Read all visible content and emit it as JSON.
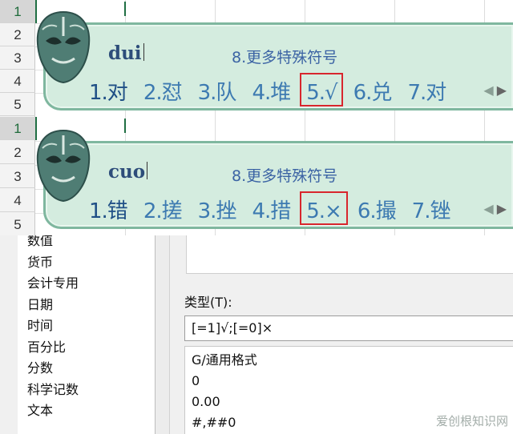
{
  "panels": [
    {
      "rows": [
        "1",
        "2",
        "3",
        "4",
        "5"
      ],
      "pinyin": "dui",
      "more_symbols": "8.更多特殊符号",
      "candidates": [
        "1.对",
        "2.怼",
        "3.队",
        "4.堆",
        "5.√",
        "6.兑",
        "7.对"
      ],
      "highlighted_index": 4
    },
    {
      "rows": [
        "1",
        "2",
        "3",
        "4",
        "5"
      ],
      "pinyin": "cuo",
      "more_symbols": "8.更多特殊符号",
      "candidates": [
        "1.错",
        "2.搓",
        "3.挫",
        "4.措",
        "5.×",
        "6.撮",
        "7.锉"
      ],
      "highlighted_index": 4
    }
  ],
  "pager": {
    "prev": "◀",
    "next": "▶"
  },
  "dialog": {
    "categories": [
      "数值",
      "货币",
      "会计专用",
      "日期",
      "时间",
      "百分比",
      "分数",
      "科学记数",
      "文本"
    ],
    "type_label": "类型(T):",
    "type_value": "[=1]√;[=0]×",
    "formats": [
      "G/通用格式",
      "0",
      "0.00",
      "#,##0"
    ]
  },
  "watermark": "爱创根知识网",
  "colors": {
    "ime_background": "#d4ecdf",
    "highlight_box": "#d8262d",
    "excel_green": "#1f6e43"
  }
}
